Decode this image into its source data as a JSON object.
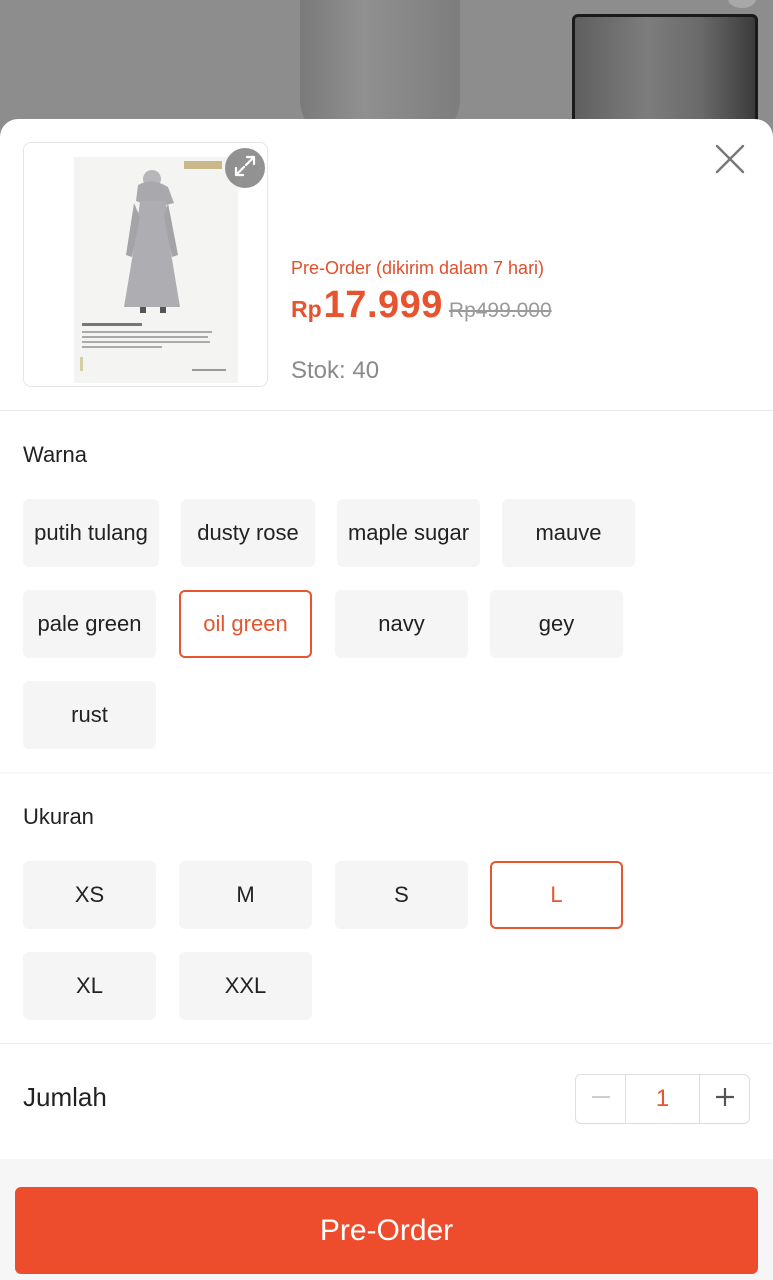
{
  "product": {
    "preorder_note": "Pre-Order (dikirim dalam 7 hari)",
    "currency": "Rp",
    "price": "17.999",
    "old_price": "Rp499.000",
    "stock": "Stok: 40"
  },
  "variants": {
    "color_label": "Warna",
    "colors": [
      "putih tulang",
      "dusty rose",
      "maple sugar",
      "mauve",
      "pale green",
      "oil green",
      "navy",
      "gey",
      "rust"
    ],
    "selected_color": "oil green",
    "size_label": "Ukuran",
    "sizes": [
      "XS",
      "M",
      "S",
      "L",
      "XL",
      "XXL"
    ],
    "selected_size": "L"
  },
  "quantity": {
    "label": "Jumlah",
    "value": "1"
  },
  "actions": {
    "preorder_button": "Pre-Order"
  },
  "icons": {
    "expand": "expand-icon",
    "close": "close-icon",
    "minus": "minus-icon",
    "plus": "plus-icon"
  },
  "colors": {
    "accent": "#ee4d2d",
    "price": "#e8532f",
    "chip_bg": "#f5f5f5"
  }
}
